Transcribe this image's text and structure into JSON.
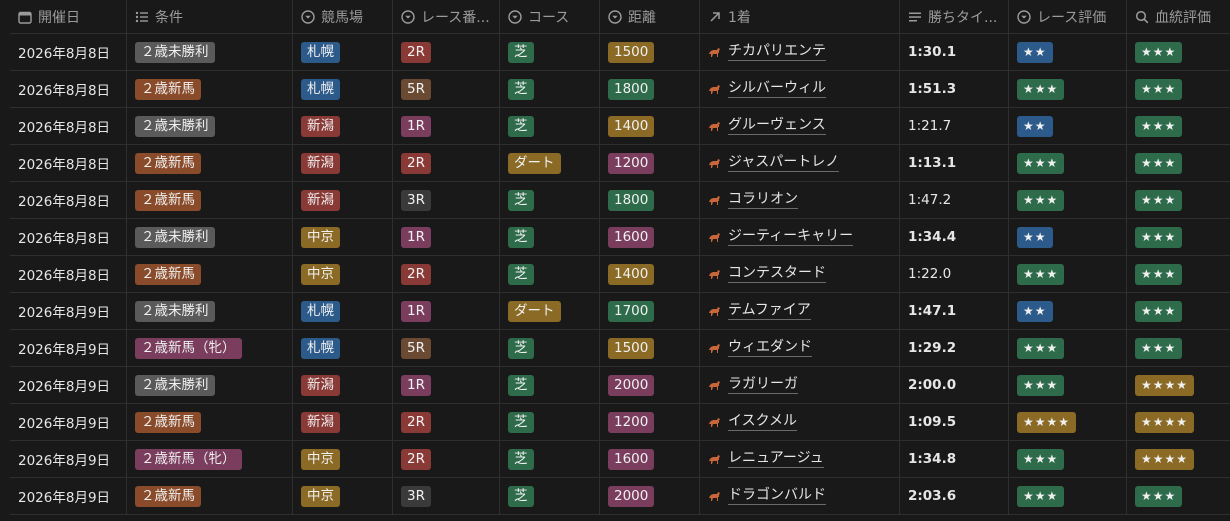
{
  "colors": {
    "gray": "#5a5a5a",
    "brown": "#8a4b2a",
    "pink": "#7a3d5e",
    "blue": "#2c5a8a",
    "red": "#8a3a36",
    "yellow": "#8a6a24",
    "purple": "#5a3f72",
    "green": "#2e6b4a",
    "dark": "#3a3a3a",
    "kg": "#6b4a34"
  },
  "columns": [
    {
      "label": "開催日",
      "icon": "calendar-icon"
    },
    {
      "label": "条件",
      "icon": "list-icon"
    },
    {
      "label": "競馬場",
      "icon": "select-icon"
    },
    {
      "label": "レース番...",
      "icon": "select-icon"
    },
    {
      "label": "コース",
      "icon": "select-icon"
    },
    {
      "label": "距離",
      "icon": "select-icon"
    },
    {
      "label": "1着",
      "icon": "relation-arrow-icon"
    },
    {
      "label": "勝ちタイ...",
      "icon": "text-lines-icon"
    },
    {
      "label": "レース評価",
      "icon": "select-icon"
    },
    {
      "label": "血統評価",
      "icon": "search-icon"
    }
  ],
  "rows": [
    {
      "date": "2026年8月8日",
      "condition": "２歳未勝利",
      "condition_color": "gray",
      "track": "札幌",
      "track_color": "blue",
      "race": "2R",
      "race_color": "red",
      "course": "芝",
      "course_color": "green",
      "distance": "1500",
      "distance_color": "yellow",
      "winner": "チカパリエンテ",
      "time": "1:30.1",
      "time_bold": true,
      "race_rating": "★★",
      "race_rating_color": "blue",
      "blood_rating": "★★★",
      "blood_rating_color": "green"
    },
    {
      "date": "2026年8月8日",
      "condition": "２歳新馬",
      "condition_color": "brown",
      "track": "札幌",
      "track_color": "blue",
      "race": "5R",
      "race_color": "kg",
      "course": "芝",
      "course_color": "green",
      "distance": "1800",
      "distance_color": "green",
      "winner": "シルバーウィル",
      "time": "1:51.3",
      "time_bold": true,
      "race_rating": "★★★",
      "race_rating_color": "green",
      "blood_rating": "★★★",
      "blood_rating_color": "green"
    },
    {
      "date": "2026年8月8日",
      "condition": "２歳未勝利",
      "condition_color": "gray",
      "track": "新潟",
      "track_color": "red",
      "race": "1R",
      "race_color": "pink",
      "course": "芝",
      "course_color": "green",
      "distance": "1400",
      "distance_color": "yellow",
      "winner": "グルーヴェンス",
      "time": "1:21.7",
      "time_bold": false,
      "race_rating": "★★",
      "race_rating_color": "blue",
      "blood_rating": "★★★",
      "blood_rating_color": "green"
    },
    {
      "date": "2026年8月8日",
      "condition": "２歳新馬",
      "condition_color": "brown",
      "track": "新潟",
      "track_color": "red",
      "race": "2R",
      "race_color": "red",
      "course": "ダート",
      "course_color": "yellow",
      "distance": "1200",
      "distance_color": "pink",
      "winner": "ジャスパートレノ",
      "time": "1:13.1",
      "time_bold": true,
      "race_rating": "★★★",
      "race_rating_color": "green",
      "blood_rating": "★★★",
      "blood_rating_color": "green"
    },
    {
      "date": "2026年8月8日",
      "condition": "２歳新馬",
      "condition_color": "brown",
      "track": "新潟",
      "track_color": "red",
      "race": "3R",
      "race_color": "dark",
      "course": "芝",
      "course_color": "green",
      "distance": "1800",
      "distance_color": "green",
      "winner": "コラリオン",
      "time": "1:47.2",
      "time_bold": false,
      "race_rating": "★★★",
      "race_rating_color": "green",
      "blood_rating": "★★★",
      "blood_rating_color": "green"
    },
    {
      "date": "2026年8月8日",
      "condition": "２歳未勝利",
      "condition_color": "gray",
      "track": "中京",
      "track_color": "yellow",
      "race": "1R",
      "race_color": "pink",
      "course": "芝",
      "course_color": "green",
      "distance": "1600",
      "distance_color": "pink",
      "winner": "ジーティーキャリー",
      "time": "1:34.4",
      "time_bold": true,
      "race_rating": "★★",
      "race_rating_color": "blue",
      "blood_rating": "★★★",
      "blood_rating_color": "green"
    },
    {
      "date": "2026年8月8日",
      "condition": "２歳新馬",
      "condition_color": "brown",
      "track": "中京",
      "track_color": "yellow",
      "race": "2R",
      "race_color": "red",
      "course": "芝",
      "course_color": "green",
      "distance": "1400",
      "distance_color": "yellow",
      "winner": "コンテスタード",
      "time": "1:22.0",
      "time_bold": false,
      "race_rating": "★★★",
      "race_rating_color": "green",
      "blood_rating": "★★★",
      "blood_rating_color": "green"
    },
    {
      "date": "2026年8月9日",
      "condition": "２歳未勝利",
      "condition_color": "gray",
      "track": "札幌",
      "track_color": "blue",
      "race": "1R",
      "race_color": "pink",
      "course": "ダート",
      "course_color": "yellow",
      "distance": "1700",
      "distance_color": "green",
      "winner": "テムファイア",
      "time": "1:47.1",
      "time_bold": true,
      "race_rating": "★★",
      "race_rating_color": "blue",
      "blood_rating": "★★★",
      "blood_rating_color": "green"
    },
    {
      "date": "2026年8月9日",
      "condition": "２歳新馬（牝）",
      "condition_color": "pink",
      "track": "札幌",
      "track_color": "blue",
      "race": "5R",
      "race_color": "kg",
      "course": "芝",
      "course_color": "green",
      "distance": "1500",
      "distance_color": "yellow",
      "winner": "ウィエダンド",
      "time": "1:29.2",
      "time_bold": true,
      "race_rating": "★★★",
      "race_rating_color": "green",
      "blood_rating": "★★★",
      "blood_rating_color": "green"
    },
    {
      "date": "2026年8月9日",
      "condition": "２歳未勝利",
      "condition_color": "gray",
      "track": "新潟",
      "track_color": "red",
      "race": "1R",
      "race_color": "pink",
      "course": "芝",
      "course_color": "green",
      "distance": "2000",
      "distance_color": "pink",
      "winner": "ラガリーガ",
      "time": "2:00.0",
      "time_bold": true,
      "race_rating": "★★★",
      "race_rating_color": "green",
      "blood_rating": "★★★★",
      "blood_rating_color": "yellow"
    },
    {
      "date": "2026年8月9日",
      "condition": "２歳新馬",
      "condition_color": "brown",
      "track": "新潟",
      "track_color": "red",
      "race": "2R",
      "race_color": "red",
      "course": "芝",
      "course_color": "green",
      "distance": "1200",
      "distance_color": "pink",
      "winner": "イスクメル",
      "time": "1:09.5",
      "time_bold": true,
      "race_rating": "★★★★",
      "race_rating_color": "yellow",
      "blood_rating": "★★★★",
      "blood_rating_color": "yellow"
    },
    {
      "date": "2026年8月9日",
      "condition": "２歳新馬（牝）",
      "condition_color": "pink",
      "track": "中京",
      "track_color": "yellow",
      "race": "2R",
      "race_color": "red",
      "course": "芝",
      "course_color": "green",
      "distance": "1600",
      "distance_color": "pink",
      "winner": "レニュアージュ",
      "time": "1:34.8",
      "time_bold": true,
      "race_rating": "★★★",
      "race_rating_color": "green",
      "blood_rating": "★★★★",
      "blood_rating_color": "yellow"
    },
    {
      "date": "2026年8月9日",
      "condition": "２歳新馬",
      "condition_color": "brown",
      "track": "中京",
      "track_color": "yellow",
      "race": "3R",
      "race_color": "dark",
      "course": "芝",
      "course_color": "green",
      "distance": "2000",
      "distance_color": "pink",
      "winner": "ドラゴンバルド",
      "time": "2:03.6",
      "time_bold": true,
      "race_rating": "★★★",
      "race_rating_color": "green",
      "blood_rating": "★★★",
      "blood_rating_color": "green"
    }
  ]
}
